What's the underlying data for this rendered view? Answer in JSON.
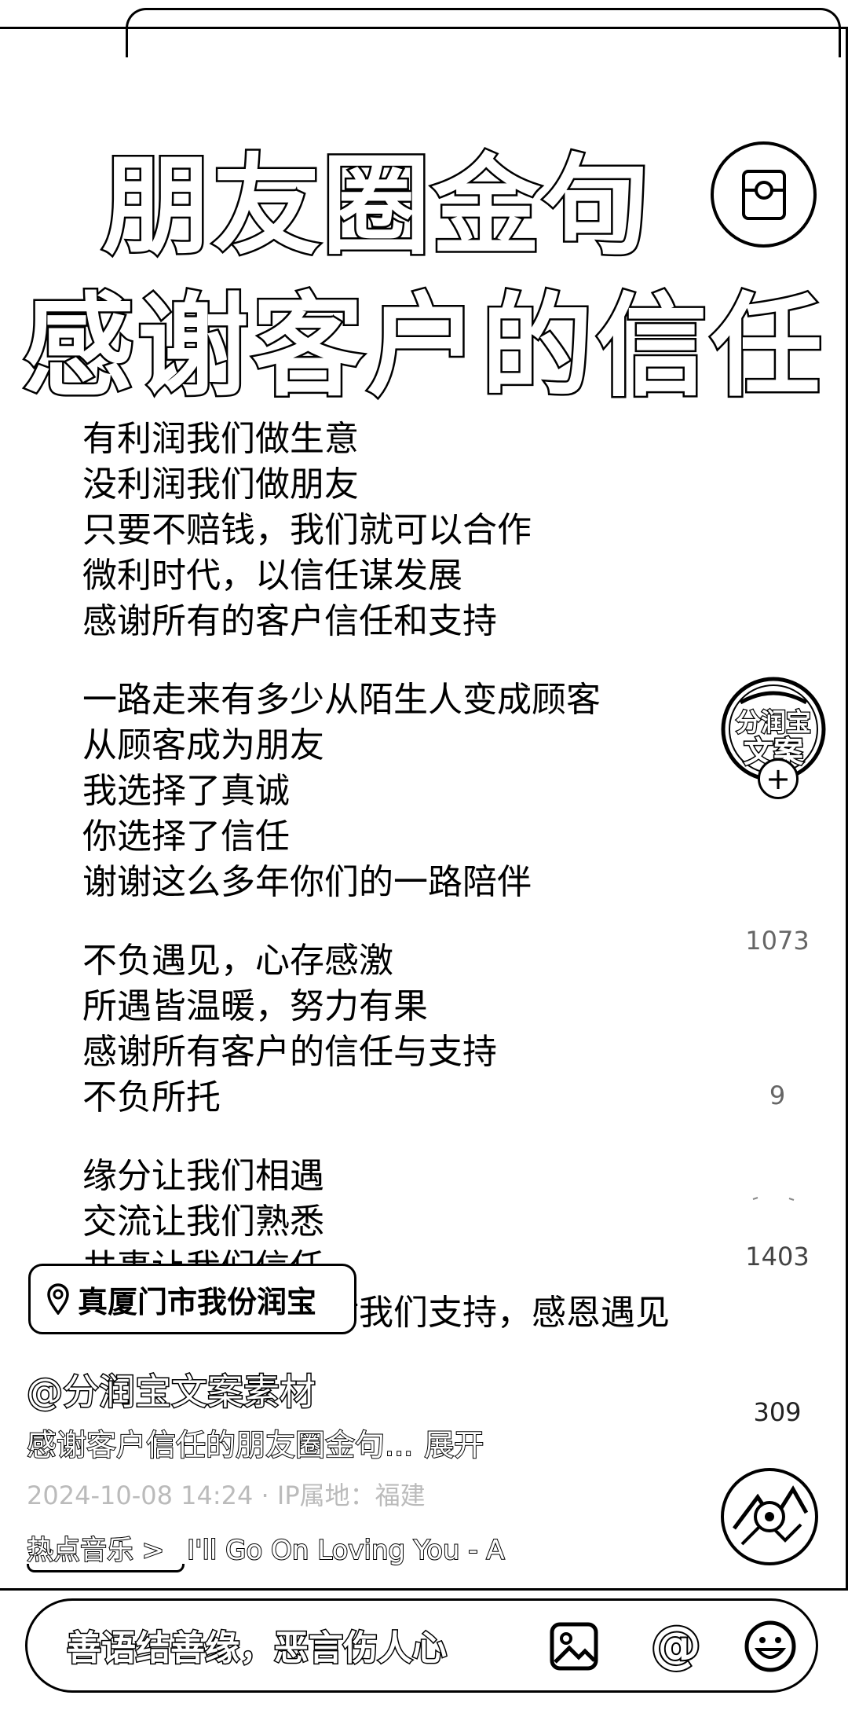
{
  "title": {
    "line1": "朋友圈金句",
    "line2": "感谢客户的信任"
  },
  "poem": {
    "stanza1": [
      "有利润我们做生意",
      "没利润我们做朋友",
      "只要不赔钱，我们就可以合作",
      "微利时代，以信任谋发展",
      "感谢所有的客户信任和支持"
    ],
    "stanza2": [
      "一路走来有多少从陌生人变成顾客",
      "从顾客成为朋友",
      "我选择了真诚",
      "你选择了信任",
      "谢谢这么多年你们的一路陪伴"
    ],
    "stanza3": [
      "不负遇见，心存感激",
      "所遇皆温暖，努力有果",
      "感谢所有客户的信任与支持",
      "不负所托"
    ],
    "stanza4": [
      "缘分让我们相遇",
      "交流让我们熟悉",
      "共事让我们信任",
      "感谢每一位顾客对我们支持，感恩遇见"
    ]
  },
  "author": {
    "avatar_text_top": "分润宝",
    "avatar_text_bottom": "文案",
    "follow_icon": "plus-icon",
    "handle": "@分润宝文案素材"
  },
  "stats": {
    "likes": "1073",
    "comments": "9",
    "collects": "1403",
    "shares": "309"
  },
  "location": {
    "icon": "location-pin-icon",
    "text": "真厦门市我份润宝"
  },
  "post": {
    "description": "感谢客户信任的朋友圈金句...",
    "expand_label": "展开",
    "meta": "2024-10-08 14:24 · IP属地：福建"
  },
  "music": {
    "label": "热点音乐 >",
    "track": "I'll Go On Loving You - A"
  },
  "comment_bar": {
    "placeholder": "善语结善缘，恶言伤人心",
    "icons": [
      "image-icon",
      "at-icon",
      "emoji-icon"
    ]
  },
  "colors": {
    "background": "#ffffff",
    "ink": "#000000",
    "muted": "#666666"
  }
}
